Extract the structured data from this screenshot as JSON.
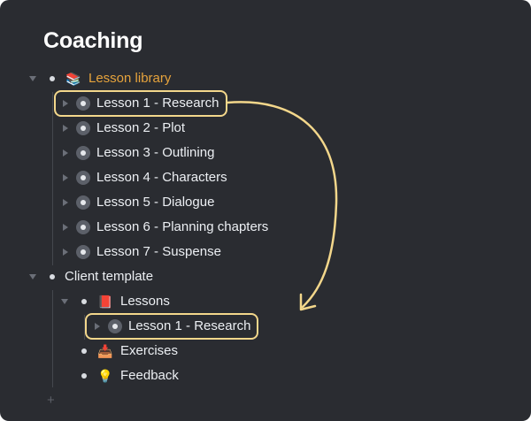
{
  "page": {
    "title": "Coaching"
  },
  "lesson_library": {
    "emoji": "📚",
    "label": "Lesson library",
    "items": [
      {
        "label": "Lesson 1 - Research"
      },
      {
        "label": "Lesson 2 - Plot"
      },
      {
        "label": "Lesson 3 - Outlining"
      },
      {
        "label": "Lesson 4 - Characters"
      },
      {
        "label": "Lesson 5 - Dialogue"
      },
      {
        "label": "Lesson 6 - Planning chapters"
      },
      {
        "label": "Lesson 7 - Suspense"
      }
    ]
  },
  "client_template": {
    "label": "Client template",
    "lessons": {
      "emoji": "📕",
      "label": "Lessons",
      "items": [
        {
          "label": "Lesson 1 - Research"
        }
      ]
    },
    "exercises": {
      "emoji": "📥",
      "label": "Exercises"
    },
    "feedback": {
      "emoji": "💡",
      "label": "Feedback"
    }
  },
  "add_item": {
    "symbol": "+"
  },
  "colors": {
    "background": "#2a2c31",
    "text": "#eceff3",
    "accent_orange": "#e6a33c",
    "highlight": "#f3d78b"
  },
  "icons": {
    "expand": "triangle-down-icon",
    "collapsed": "triangle-right-icon",
    "bullet": "bullet-dot-icon",
    "mirror_bullet": "mirror-bullet-icon",
    "connector": "curved-arrow-icon"
  }
}
